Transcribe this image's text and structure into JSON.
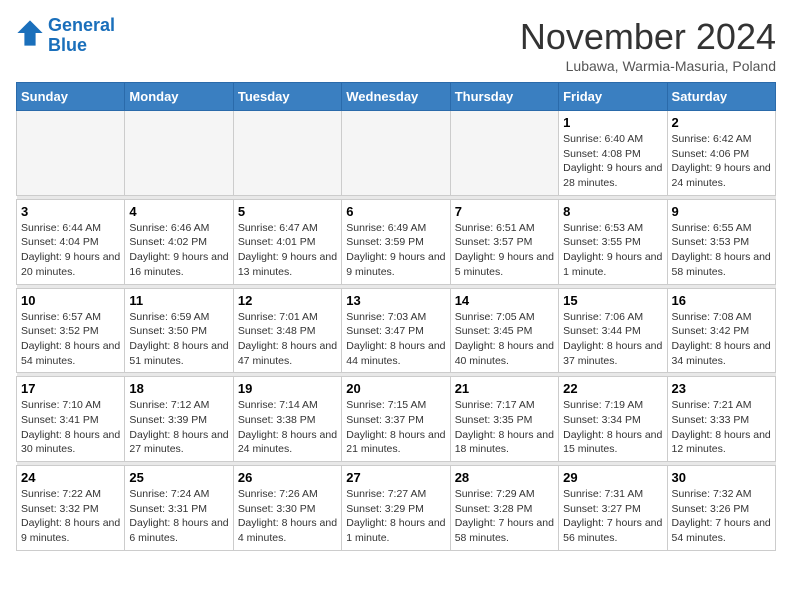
{
  "logo": {
    "line1": "General",
    "line2": "Blue"
  },
  "title": "November 2024",
  "location": "Lubawa, Warmia-Masuria, Poland",
  "days_of_week": [
    "Sunday",
    "Monday",
    "Tuesday",
    "Wednesday",
    "Thursday",
    "Friday",
    "Saturday"
  ],
  "weeks": [
    {
      "days": [
        {
          "num": "",
          "info": ""
        },
        {
          "num": "",
          "info": ""
        },
        {
          "num": "",
          "info": ""
        },
        {
          "num": "",
          "info": ""
        },
        {
          "num": "",
          "info": ""
        },
        {
          "num": "1",
          "info": "Sunrise: 6:40 AM\nSunset: 4:08 PM\nDaylight: 9 hours and 28 minutes."
        },
        {
          "num": "2",
          "info": "Sunrise: 6:42 AM\nSunset: 4:06 PM\nDaylight: 9 hours and 24 minutes."
        }
      ]
    },
    {
      "days": [
        {
          "num": "3",
          "info": "Sunrise: 6:44 AM\nSunset: 4:04 PM\nDaylight: 9 hours and 20 minutes."
        },
        {
          "num": "4",
          "info": "Sunrise: 6:46 AM\nSunset: 4:02 PM\nDaylight: 9 hours and 16 minutes."
        },
        {
          "num": "5",
          "info": "Sunrise: 6:47 AM\nSunset: 4:01 PM\nDaylight: 9 hours and 13 minutes."
        },
        {
          "num": "6",
          "info": "Sunrise: 6:49 AM\nSunset: 3:59 PM\nDaylight: 9 hours and 9 minutes."
        },
        {
          "num": "7",
          "info": "Sunrise: 6:51 AM\nSunset: 3:57 PM\nDaylight: 9 hours and 5 minutes."
        },
        {
          "num": "8",
          "info": "Sunrise: 6:53 AM\nSunset: 3:55 PM\nDaylight: 9 hours and 1 minute."
        },
        {
          "num": "9",
          "info": "Sunrise: 6:55 AM\nSunset: 3:53 PM\nDaylight: 8 hours and 58 minutes."
        }
      ]
    },
    {
      "days": [
        {
          "num": "10",
          "info": "Sunrise: 6:57 AM\nSunset: 3:52 PM\nDaylight: 8 hours and 54 minutes."
        },
        {
          "num": "11",
          "info": "Sunrise: 6:59 AM\nSunset: 3:50 PM\nDaylight: 8 hours and 51 minutes."
        },
        {
          "num": "12",
          "info": "Sunrise: 7:01 AM\nSunset: 3:48 PM\nDaylight: 8 hours and 47 minutes."
        },
        {
          "num": "13",
          "info": "Sunrise: 7:03 AM\nSunset: 3:47 PM\nDaylight: 8 hours and 44 minutes."
        },
        {
          "num": "14",
          "info": "Sunrise: 7:05 AM\nSunset: 3:45 PM\nDaylight: 8 hours and 40 minutes."
        },
        {
          "num": "15",
          "info": "Sunrise: 7:06 AM\nSunset: 3:44 PM\nDaylight: 8 hours and 37 minutes."
        },
        {
          "num": "16",
          "info": "Sunrise: 7:08 AM\nSunset: 3:42 PM\nDaylight: 8 hours and 34 minutes."
        }
      ]
    },
    {
      "days": [
        {
          "num": "17",
          "info": "Sunrise: 7:10 AM\nSunset: 3:41 PM\nDaylight: 8 hours and 30 minutes."
        },
        {
          "num": "18",
          "info": "Sunrise: 7:12 AM\nSunset: 3:39 PM\nDaylight: 8 hours and 27 minutes."
        },
        {
          "num": "19",
          "info": "Sunrise: 7:14 AM\nSunset: 3:38 PM\nDaylight: 8 hours and 24 minutes."
        },
        {
          "num": "20",
          "info": "Sunrise: 7:15 AM\nSunset: 3:37 PM\nDaylight: 8 hours and 21 minutes."
        },
        {
          "num": "21",
          "info": "Sunrise: 7:17 AM\nSunset: 3:35 PM\nDaylight: 8 hours and 18 minutes."
        },
        {
          "num": "22",
          "info": "Sunrise: 7:19 AM\nSunset: 3:34 PM\nDaylight: 8 hours and 15 minutes."
        },
        {
          "num": "23",
          "info": "Sunrise: 7:21 AM\nSunset: 3:33 PM\nDaylight: 8 hours and 12 minutes."
        }
      ]
    },
    {
      "days": [
        {
          "num": "24",
          "info": "Sunrise: 7:22 AM\nSunset: 3:32 PM\nDaylight: 8 hours and 9 minutes."
        },
        {
          "num": "25",
          "info": "Sunrise: 7:24 AM\nSunset: 3:31 PM\nDaylight: 8 hours and 6 minutes."
        },
        {
          "num": "26",
          "info": "Sunrise: 7:26 AM\nSunset: 3:30 PM\nDaylight: 8 hours and 4 minutes."
        },
        {
          "num": "27",
          "info": "Sunrise: 7:27 AM\nSunset: 3:29 PM\nDaylight: 8 hours and 1 minute."
        },
        {
          "num": "28",
          "info": "Sunrise: 7:29 AM\nSunset: 3:28 PM\nDaylight: 7 hours and 58 minutes."
        },
        {
          "num": "29",
          "info": "Sunrise: 7:31 AM\nSunset: 3:27 PM\nDaylight: 7 hours and 56 minutes."
        },
        {
          "num": "30",
          "info": "Sunrise: 7:32 AM\nSunset: 3:26 PM\nDaylight: 7 hours and 54 minutes."
        }
      ]
    }
  ]
}
